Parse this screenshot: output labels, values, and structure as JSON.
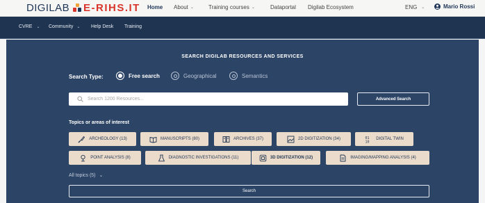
{
  "header": {
    "logo_prefix": "DIGILAB",
    "logo_suffix": "E-RIHS.IT",
    "nav": [
      {
        "label": "Home",
        "caret": false
      },
      {
        "label": "About",
        "caret": true
      },
      {
        "label": "Training courses",
        "caret": true
      },
      {
        "label": "Dataportal",
        "caret": false
      },
      {
        "label": "Digilab Ecosystem",
        "caret": false
      }
    ],
    "language": "ENG",
    "user_name": "Mario Rossi"
  },
  "subnav": [
    {
      "label": "CVRE",
      "caret": true
    },
    {
      "label": "Community",
      "caret": true
    },
    {
      "label": "Help Desk",
      "caret": false
    },
    {
      "label": "Training",
      "caret": false
    }
  ],
  "search": {
    "title": "SEARCH DIGILAB RESOURCES AND SERVICES",
    "type_label": "Search Type:",
    "types": [
      {
        "label": "Free search",
        "selected": true
      },
      {
        "label": "Geographical",
        "selected": false
      },
      {
        "label": "Semantics",
        "selected": false
      }
    ],
    "placeholder": "Search 1200 Resources...",
    "advanced_label": "Advanced Search",
    "topics_title": "Topics or areas of interest",
    "topics": [
      {
        "label": "ARCHEOLOGY (13)",
        "icon": "trowel-icon"
      },
      {
        "label": "MANUSCRIPTS (80)",
        "icon": "book-icon"
      },
      {
        "label": "ARCHIVES (37)",
        "icon": "archive-icon"
      },
      {
        "label": "2D DIGITIZATION (34)",
        "icon": "image-icon"
      },
      {
        "label": "DIGITAL TWIN",
        "icon": "binary-icon"
      },
      {
        "label": "POINT ANALYSIS (8)",
        "icon": "location-pin-icon"
      },
      {
        "label": "DIAGNOSTIC INVESTIGATIONS (11)",
        "icon": "flask-icon"
      },
      {
        "label": "3D DIGITIZATION (12)",
        "icon": "cube-icon"
      },
      {
        "label": "IMAGING/MAPPING ANALYSIS (4)",
        "icon": "scan-document-icon"
      }
    ],
    "all_topics": "All topics (5)",
    "search_button": "Search"
  }
}
